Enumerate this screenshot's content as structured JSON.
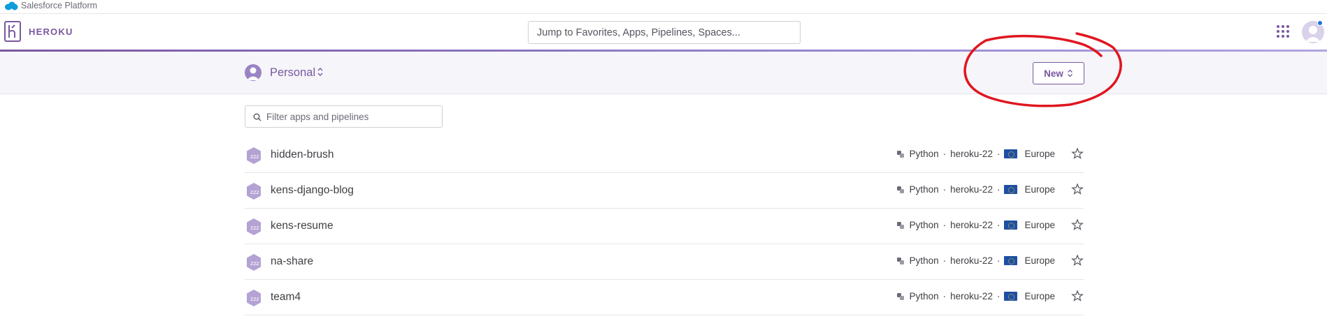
{
  "topbar": {
    "label": "Salesforce Platform"
  },
  "header": {
    "logo_text": "HEROKU",
    "search_placeholder": "Jump to Favorites, Apps, Pipelines, Spaces..."
  },
  "subheader": {
    "team_label": "Personal",
    "new_button_label": "New"
  },
  "filter": {
    "placeholder": "Filter apps and pipelines"
  },
  "apps": [
    {
      "name": "hidden-brush",
      "language": "Python",
      "stack": "heroku-22",
      "region": "Europe",
      "separator": "·"
    },
    {
      "name": "kens-django-blog",
      "language": "Python",
      "stack": "heroku-22",
      "region": "Europe",
      "separator": "·"
    },
    {
      "name": "kens-resume",
      "language": "Python",
      "stack": "heroku-22",
      "region": "Europe",
      "separator": "·"
    },
    {
      "name": "na-share",
      "language": "Python",
      "stack": "heroku-22",
      "region": "Europe",
      "separator": "·"
    },
    {
      "name": "team4",
      "language": "Python",
      "stack": "heroku-22",
      "region": "Europe",
      "separator": "·"
    }
  ],
  "colors": {
    "brand": "#79589f",
    "annotation": "#e0161f",
    "notification": "#1a74d9"
  },
  "icons": {
    "cloud": "salesforce-cloud-icon",
    "apps_grid": "grid-icon",
    "language": "python-icon",
    "sleep": "sleeping-dyno-icon",
    "favorite": "star-icon",
    "region": "eu-flag-icon"
  }
}
